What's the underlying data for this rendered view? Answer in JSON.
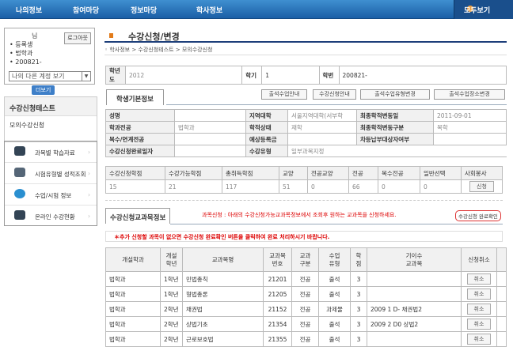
{
  "nav": {
    "items": [
      "나의정보",
      "참여마당",
      "정보마당",
      "학사정보"
    ],
    "all": "모두보기"
  },
  "login": {
    "name_suffix": "님",
    "logout": "로그아웃",
    "status": "등록생",
    "dept": "법학과",
    "id": "200821-",
    "select": "나의 다른 계정 보기",
    "more": "더보기"
  },
  "side": {
    "section": "수강신청테스트",
    "item": "모의수강신청",
    "menu": [
      "과목별 학습자료",
      "시험유형별 성적조회",
      "수업/시험 정보",
      "온라인 수강현황"
    ]
  },
  "page": {
    "title": "수강신청/변경",
    "breadcrumb": "학사정보 > 수강신청테스트 > 모의수강신청"
  },
  "term": {
    "year_label": "학년도",
    "year": "2012",
    "sem_label": "학기",
    "sem": "1",
    "id_label": "학번",
    "id": "200821-"
  },
  "tabs": {
    "basic": "학생기본정보",
    "courses": "수강신청교과목정보"
  },
  "buttons": [
    "출석수업안내",
    "수강신청안내",
    "출석수업유형변경",
    "출석수업장소변경"
  ],
  "info": {
    "rows": [
      [
        "성명",
        "",
        "지역대학",
        "서울지역대학(서부학",
        "최종학적변동일",
        "2011-09-01"
      ],
      [
        "학과전공",
        "법학과",
        "학적상태",
        "재학",
        "최종학적변동구분",
        "복학"
      ],
      [
        "복수/연계전공",
        "",
        "예상등록금",
        "",
        "차등납부대상자여부",
        ""
      ],
      [
        "수강신청완료일자",
        "",
        "수강유형",
        "일부과목지정",
        "",
        ""
      ]
    ]
  },
  "credits": {
    "headers": [
      "수강신청학점",
      "수강가능학점",
      "총취득학점",
      "교양",
      "전공교양",
      "전공",
      "복수전공",
      "일반선택",
      "사회봉사"
    ],
    "values": [
      "15",
      "21",
      "117",
      "51",
      "0",
      "66",
      "0",
      "0"
    ],
    "apply": "신청"
  },
  "notice": {
    "msg": "과목신청 : 아래의 수강신청가능교과목정보에서 조회후 원하는 교과목을 신청하세요.",
    "confirm": "수강신청 완료확인",
    "warn": "＊추가 신청할 과목이 없으면 수강신청 완료확인 버튼을 클릭하여 완료 처리하시기 바랍니다."
  },
  "courses": {
    "headers": [
      "개설학과",
      "개설\n학년",
      "교과목명",
      "교과목\n번호",
      "교과\n구분",
      "수업\n유형",
      "학점",
      "기이수\n교과목",
      "신청취소"
    ],
    "rows": [
      [
        "법학과",
        "1학년",
        "민법총칙",
        "21201",
        "전공",
        "출석",
        "3",
        ""
      ],
      [
        "법학과",
        "1학년",
        "형법총론",
        "21205",
        "전공",
        "출석",
        "3",
        ""
      ],
      [
        "법학과",
        "2학년",
        "채권법",
        "21152",
        "전공",
        "과제물",
        "3",
        "2009 1 D- 채권법2"
      ],
      [
        "법학과",
        "2학년",
        "상법기초",
        "21354",
        "전공",
        "출석",
        "3",
        "2009 2 D0 상법2"
      ],
      [
        "법학과",
        "2학년",
        "근로보호법",
        "21355",
        "전공",
        "출석",
        "3",
        ""
      ]
    ],
    "cancel": "취소"
  }
}
